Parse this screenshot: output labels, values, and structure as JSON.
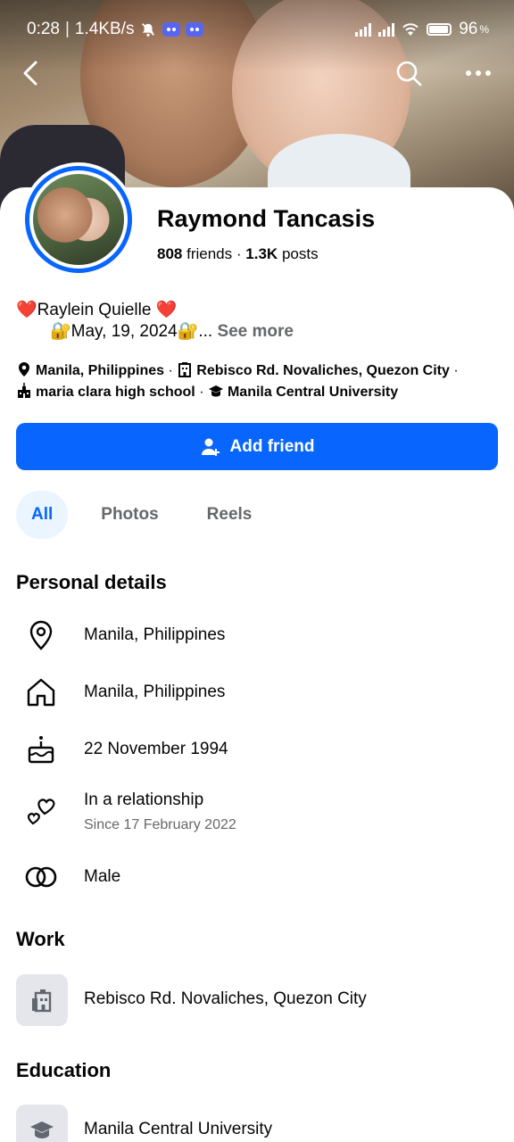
{
  "status_bar": {
    "time": "0:28",
    "net_speed": "1.4KB/s",
    "battery": "96"
  },
  "profile": {
    "name": "Raymond Tancasis",
    "friends_count": "808",
    "friends_label": "friends",
    "separator": "·",
    "posts_count": "1.3K",
    "posts_label": "posts",
    "bio_line1": "❤️Raylein Quielle ❤️",
    "bio_line2": "🔐May, 19, 2024🔐... ",
    "see_more": "See more",
    "intro": {
      "location": "Manila, Philippines",
      "workplace": "Rebisco Rd. Novaliches, Quezon City",
      "school": "maria clara high school",
      "college": "Manila Central University"
    }
  },
  "actions": {
    "add_friend": "Add friend"
  },
  "tabs": [
    "All",
    "Photos",
    "Reels"
  ],
  "personal_details": {
    "title": "Personal details",
    "current_city": "Manila, Philippines",
    "hometown": "Manila, Philippines",
    "birthday": "22 November 1994",
    "relationship": "In a relationship",
    "relationship_since": "Since 17 February 2022",
    "gender": "Male"
  },
  "work": {
    "title": "Work",
    "item": "Rebisco Rd. Novaliches, Quezon City"
  },
  "education": {
    "title": "Education",
    "item": "Manila Central University"
  },
  "colors": {
    "accent": "#0866FF",
    "muted_text": "#65676B",
    "tab_active_bg": "#EBF5FF",
    "icon_box_bg": "#E4E6EB"
  }
}
